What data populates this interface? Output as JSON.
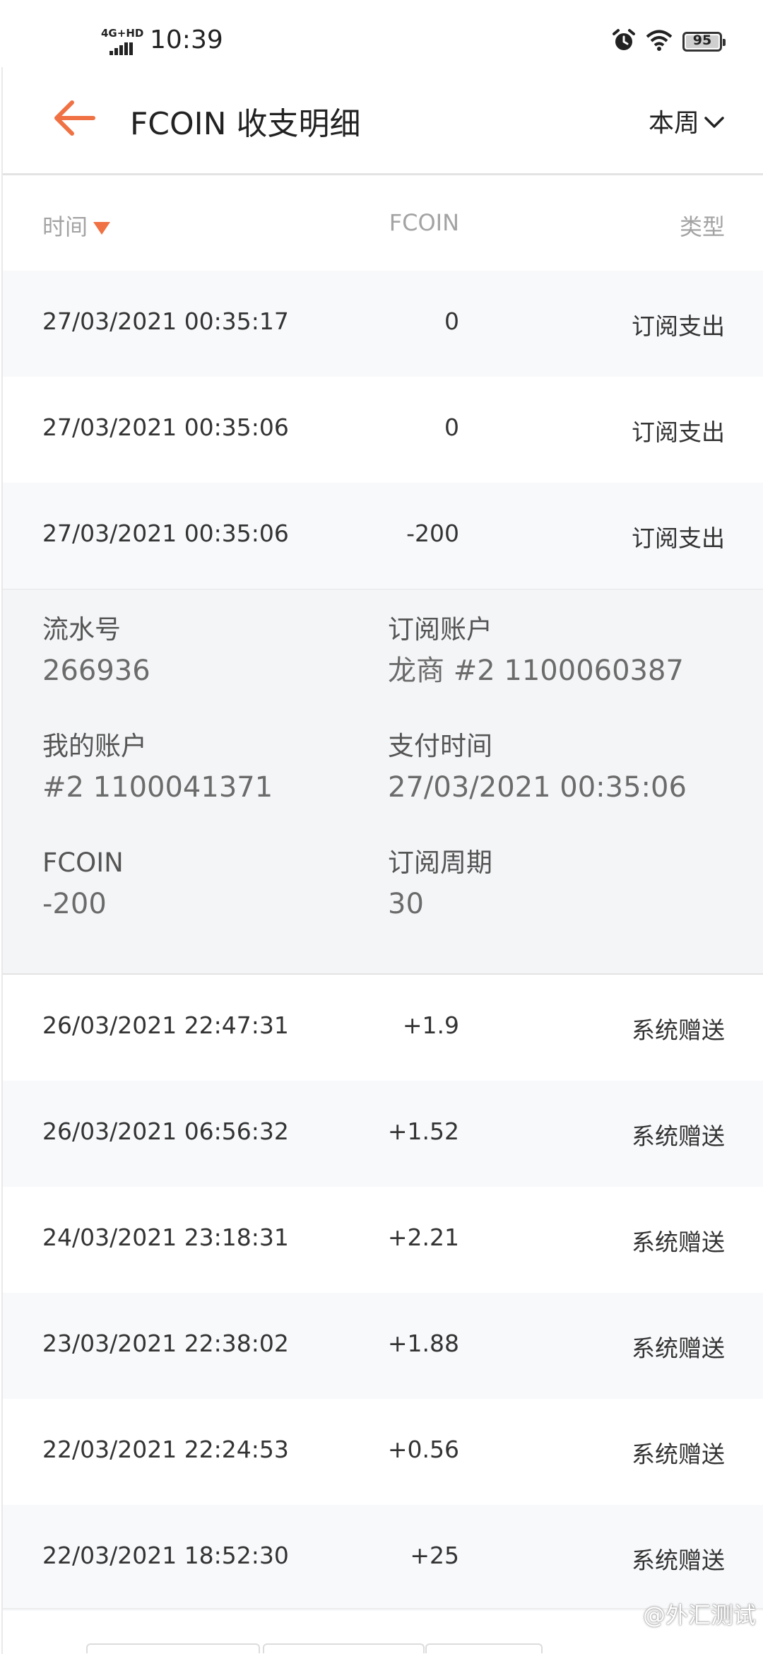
{
  "status_bar": {
    "network": "4G+HD",
    "time": "10:39",
    "battery": "95",
    "icons": [
      "alarm-icon",
      "wifi-icon",
      "battery-icon"
    ]
  },
  "header": {
    "back_icon": "back-arrow-icon",
    "title": "FCOIN 收支明细",
    "period": "本周",
    "period_icon": "chevron-down-icon"
  },
  "columns": {
    "time": "时间",
    "fcoin": "FCOIN",
    "type": "类型"
  },
  "rows_top": [
    {
      "time": "27/03/2021 00:35:17",
      "amount": "0",
      "type": "订阅支出"
    },
    {
      "time": "27/03/2021 00:35:06",
      "amount": "0",
      "type": "订阅支出"
    },
    {
      "time": "27/03/2021 00:35:06",
      "amount": "-200",
      "type": "订阅支出"
    }
  ],
  "detail": {
    "serial_label": "流水号",
    "serial_value": "266936",
    "sub_account_label": "订阅账户",
    "sub_account_value": "龙商 #2 1100060387",
    "my_account_label": "我的账户",
    "my_account_value": "#2 1100041371",
    "pay_time_label": "支付时间",
    "pay_time_value": "27/03/2021 00:35:06",
    "fcoin_label": "FCOIN",
    "fcoin_value": "-200",
    "period_label": "订阅周期",
    "period_value": "30"
  },
  "rows_bottom": [
    {
      "time": "26/03/2021 22:47:31",
      "amount": "+1.9",
      "type": "系统赠送"
    },
    {
      "time": "26/03/2021 06:56:32",
      "amount": "+1.52",
      "type": "系统赠送"
    },
    {
      "time": "24/03/2021 23:18:31",
      "amount": "+2.21",
      "type": "系统赠送"
    },
    {
      "time": "23/03/2021 22:38:02",
      "amount": "+1.88",
      "type": "系统赠送"
    },
    {
      "time": "22/03/2021 22:24:53",
      "amount": "+0.56",
      "type": "系统赠送"
    },
    {
      "time": "22/03/2021 18:52:30",
      "amount": "+25",
      "type": "系统赠送"
    }
  ],
  "watermark": "@外汇测试",
  "colors": {
    "accent": "#f07143",
    "row_alt": "#f8f9fb",
    "detail_bg": "#f4f5f7"
  }
}
